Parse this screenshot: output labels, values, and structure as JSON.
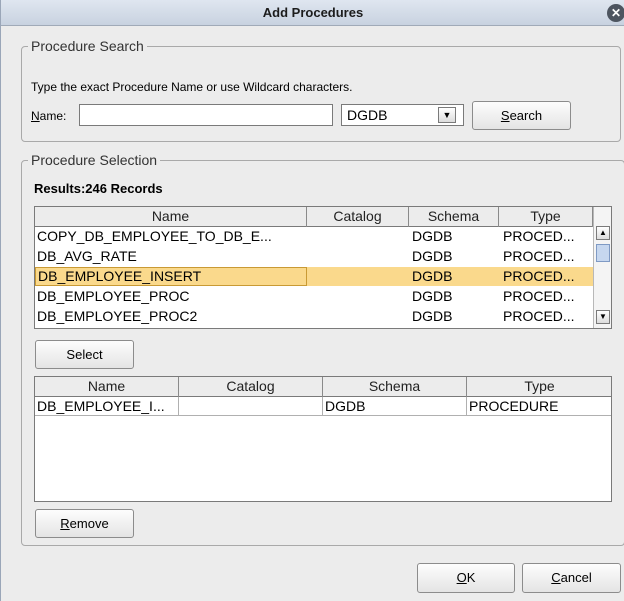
{
  "dialog": {
    "title": "Add Procedures",
    "close_icon": "close-icon"
  },
  "search": {
    "legend": "Procedure Search",
    "instructions": "Type the exact Procedure Name or use Wildcard characters.",
    "name_label": "Name:",
    "name_value": "",
    "schema_value": "DGDB",
    "search_button": "Search"
  },
  "selection": {
    "legend": "Procedure Selection",
    "results": "Results:246 Records",
    "columns": [
      "Name",
      "Catalog",
      "Schema",
      "Type"
    ],
    "rows": [
      {
        "name": "COPY_DB_EMPLOYEE_TO_DB_E...",
        "catalog": "",
        "schema": "DGDB",
        "type": "PROCED..."
      },
      {
        "name": "DB_AVG_RATE",
        "catalog": "",
        "schema": "DGDB",
        "type": "PROCED..."
      },
      {
        "name": "DB_EMPLOYEE_INSERT",
        "catalog": "",
        "schema": "DGDB",
        "type": "PROCED..."
      },
      {
        "name": "DB_EMPLOYEE_PROC",
        "catalog": "",
        "schema": "DGDB",
        "type": "PROCED..."
      },
      {
        "name": "DB_EMPLOYEE_PROC2",
        "catalog": "",
        "schema": "DGDB",
        "type": "PROCED..."
      }
    ],
    "selected_row": "DB_EMPLOYEE_INSERT",
    "select_button": "Select",
    "selected_columns": [
      "Name",
      "Catalog",
      "Schema",
      "Type"
    ],
    "selected_rows": [
      {
        "name": "DB_EMPLOYEE_I...",
        "catalog": "",
        "schema": "DGDB",
        "type": "PROCEDURE"
      }
    ],
    "remove_button": "Remove"
  },
  "footer": {
    "ok_button": "OK",
    "cancel_button": "Cancel"
  },
  "colors": {
    "selected_row": "#fad98c",
    "scroll_thumb": "#c6d7ef"
  }
}
